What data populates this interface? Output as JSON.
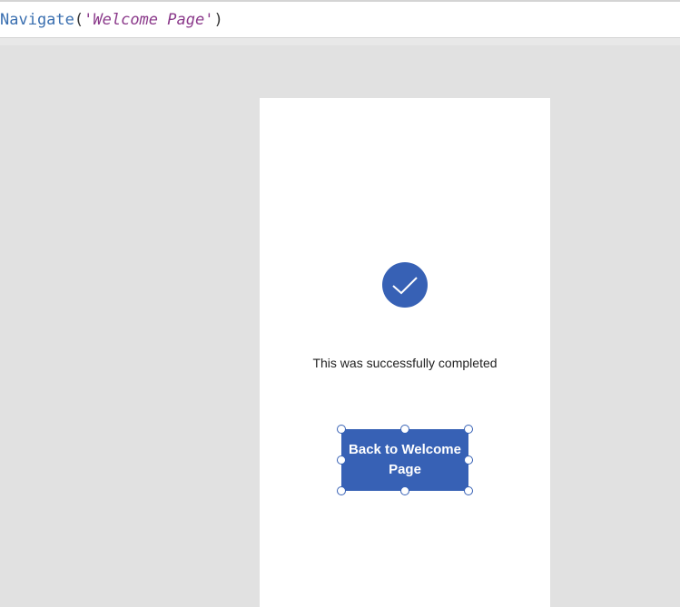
{
  "formula_bar": {
    "function_name": "Navigate",
    "open_paren": "(",
    "argument": "'Welcome Page'",
    "close_paren": ")"
  },
  "screen": {
    "success_icon": "checkmark-icon",
    "success_message": "This was successfully completed",
    "back_button_label": "Back to Welcome Page"
  },
  "colors": {
    "accent": "#3761b5",
    "canvas_background": "#e1e1e1",
    "function_color": "#3a6fb0",
    "string_color": "#8b3a8b"
  }
}
